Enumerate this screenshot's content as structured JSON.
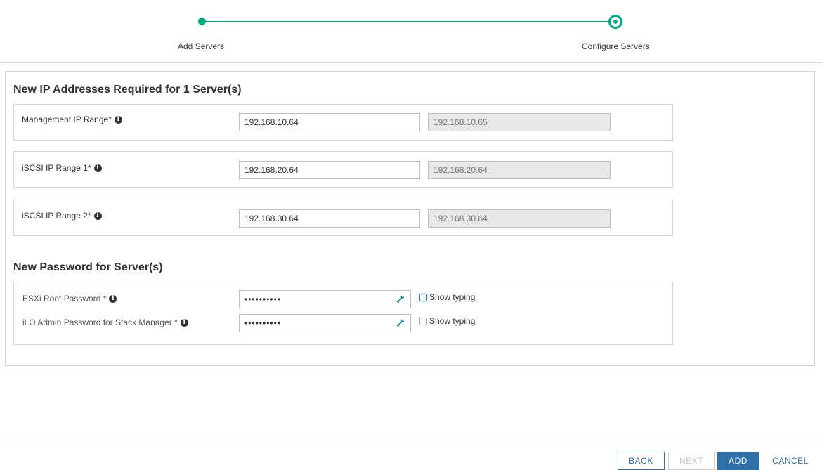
{
  "stepper": {
    "steps": [
      {
        "label": "Add Servers",
        "state": "completed"
      },
      {
        "label": "Configure Servers",
        "state": "current"
      }
    ],
    "accent_color": "#01a982"
  },
  "ip_section": {
    "title": "New IP Addresses Required for 1 Server(s)",
    "rows": [
      {
        "label": "Management IP Range*",
        "start_value": "192.168.10.64",
        "end_value": "192.168.10.65"
      },
      {
        "label": "iSCSI IP Range 1*",
        "start_value": "192.168.20.64",
        "end_value": "192.168.20.64"
      },
      {
        "label": "iSCSI IP Range 2*",
        "start_value": "192.168.30.64",
        "end_value": "192.168.30.64"
      }
    ]
  },
  "password_section": {
    "title": "New Password for Server(s)",
    "rows": [
      {
        "label": "ESXi Root Password *",
        "value": "••••••••••",
        "show_typing_label": "Show typing",
        "show_typing_checked": false
      },
      {
        "label": "iLO Admin Password for Stack Manager *",
        "value": "••••••••••",
        "show_typing_label": "Show typing",
        "show_typing_checked": false
      }
    ]
  },
  "footer": {
    "back_label": "BACK",
    "next_label": "NEXT",
    "add_label": "ADD",
    "cancel_label": "CANCEL",
    "primary_color": "#2f6fa8"
  },
  "icons": {
    "info": "info-circle-icon",
    "key": "key-icon"
  }
}
